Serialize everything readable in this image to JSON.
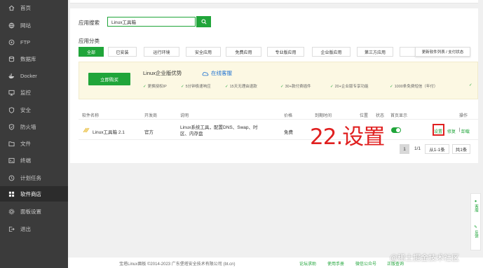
{
  "sidebar": {
    "items": [
      {
        "label": "首页",
        "icon": "home-icon"
      },
      {
        "label": "网站",
        "icon": "globe-icon"
      },
      {
        "label": "FTP",
        "icon": "ftp-icon"
      },
      {
        "label": "数据库",
        "icon": "database-icon"
      },
      {
        "label": "Docker",
        "icon": "docker-icon"
      },
      {
        "label": "监控",
        "icon": "monitor-icon"
      },
      {
        "label": "安全",
        "icon": "shield-icon"
      },
      {
        "label": "防火墙",
        "icon": "firewall-icon"
      },
      {
        "label": "文件",
        "icon": "folder-icon"
      },
      {
        "label": "终端",
        "icon": "terminal-icon"
      },
      {
        "label": "计划任务",
        "icon": "clock-icon"
      },
      {
        "label": "软件商店",
        "icon": "grid-icon",
        "active": true
      },
      {
        "label": "面板设置",
        "icon": "gear-icon"
      },
      {
        "label": "退出",
        "icon": "logout-icon"
      }
    ]
  },
  "search": {
    "label": "应用搜索",
    "value": "Linux工具箱"
  },
  "category": {
    "label": "应用分类",
    "items": [
      "全部",
      "已安装",
      "运行环境",
      "安全应用",
      "免费应用",
      "专业版应用",
      "企业版应用",
      "第三方应用"
    ],
    "tooltip": "更新软件列表 / 支付状态"
  },
  "promo": {
    "buy_label": "立即购买",
    "title": "Linux企业版优势",
    "service": "在线客服",
    "features": [
      "更换授权IP",
      "5分钟极速响应",
      "15天无理由退款",
      "30+款付费插件",
      "20+企业版专享功能",
      "1000条免费短信（年付）"
    ]
  },
  "table": {
    "headers": {
      "name": "软件名称",
      "dev": "开发商",
      "desc": "说明",
      "price": "价格",
      "expire": "到期时间",
      "pos": "位置",
      "status": "状态",
      "home": "首页显示",
      "op": "操作"
    },
    "row": {
      "name": "Linux工具箱 2.1",
      "dev": "官方",
      "desc": "Linux系统工具，配置DNS、Swap、时区、内存盘",
      "price": "免费",
      "op_settings": "设置",
      "op_repair": "修复",
      "op_uninstall": "卸载"
    },
    "annotation": "22.设置"
  },
  "pager": {
    "current": "1",
    "pages": "1/1",
    "range": "从1-1条",
    "total": "共1条"
  },
  "footer": {
    "copyright": "宝塔Linux面板 ©2014-2023 广东堡塔安全技术有限公司 (bt.cn)",
    "links": [
      "论坛求助",
      "使用手册",
      "微信公众号",
      "正版查询"
    ]
  },
  "float": {
    "service": "客服",
    "feedback": "反馈"
  },
  "watermark": "@稀土掘金技术社区",
  "colors": {
    "accent": "#20a53a",
    "sidebar": "#3b3b3b",
    "annotation": "#e02020",
    "link": "#1a6fd1"
  }
}
